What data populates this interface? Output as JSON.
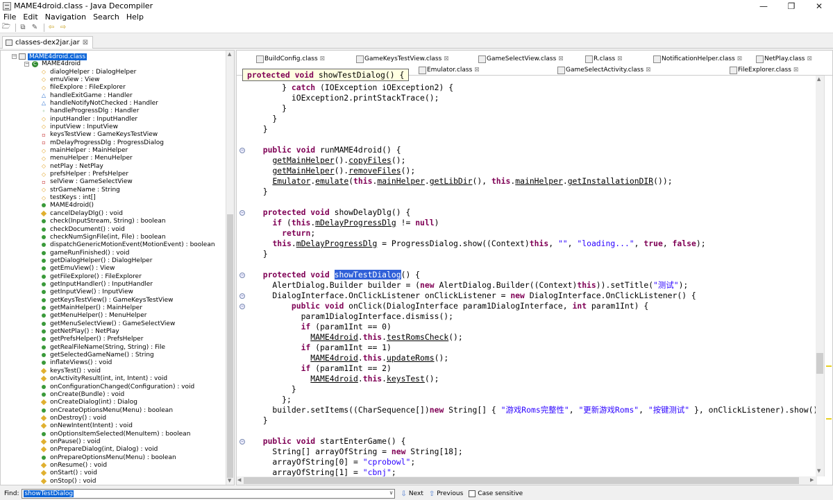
{
  "window": {
    "title": "MAME4droid.class - Java Decompiler",
    "minimize": "—",
    "restore": "❐",
    "close": "✕"
  },
  "menu": [
    "File",
    "Edit",
    "Navigation",
    "Search",
    "Help"
  ],
  "file_tab": {
    "label": "classes-dex2jar.jar",
    "close": "⊠"
  },
  "tree": {
    "root": "MAME4droid.class",
    "class": "MAME4droid",
    "items": [
      {
        "label": "dialogHelper : DialogHelper",
        "kind": "field-prot"
      },
      {
        "label": "emuView : View",
        "kind": "field-prot"
      },
      {
        "label": "fileExplore : FileExplorer",
        "kind": "field-prot"
      },
      {
        "label": "handleExitGame : Handler",
        "kind": "field-def"
      },
      {
        "label": "handleNotifyNotChecked : Handler",
        "kind": "field-def"
      },
      {
        "label": "handleProgressDlg : Handler",
        "kind": "field-pub"
      },
      {
        "label": "inputHandler : InputHandler",
        "kind": "field-prot"
      },
      {
        "label": "inputView : InputView",
        "kind": "field-prot"
      },
      {
        "label": "keysTestView : GameKeysTestView",
        "kind": "field-priv"
      },
      {
        "label": "mDelayProgressDlg : ProgressDialog",
        "kind": "field-priv"
      },
      {
        "label": "mainHelper : MainHelper",
        "kind": "field-prot"
      },
      {
        "label": "menuHelper : MenuHelper",
        "kind": "field-prot"
      },
      {
        "label": "netPlay : NetPlay",
        "kind": "field-prot"
      },
      {
        "label": "prefsHelper : PrefsHelper",
        "kind": "field-prot"
      },
      {
        "label": "selView : GameSelectView",
        "kind": "field-priv"
      },
      {
        "label": "strGameName : String",
        "kind": "field-prot"
      },
      {
        "label": "testKeys : int[]",
        "kind": "field-prot"
      },
      {
        "label": "MAME4droid()",
        "kind": "method"
      },
      {
        "label": "cancelDelayDlg() : void",
        "kind": "method-prot"
      },
      {
        "label": "check(InputStream, String) : boolean",
        "kind": "method"
      },
      {
        "label": "checkDocument() : void",
        "kind": "method"
      },
      {
        "label": "checkNumSignFile(int, File) : boolean",
        "kind": "method"
      },
      {
        "label": "dispatchGenericMotionEvent(MotionEvent) : boolean",
        "kind": "method"
      },
      {
        "label": "gameRunFinished() : void",
        "kind": "method"
      },
      {
        "label": "getDialogHelper() : DialogHelper",
        "kind": "method"
      },
      {
        "label": "getEmuView() : View",
        "kind": "method"
      },
      {
        "label": "getFileExplore() : FileExplorer",
        "kind": "method"
      },
      {
        "label": "getInputHandler() : InputHandler",
        "kind": "method"
      },
      {
        "label": "getInputView() : InputView",
        "kind": "method"
      },
      {
        "label": "getKeysTestView() : GameKeysTestView",
        "kind": "method"
      },
      {
        "label": "getMainHelper() : MainHelper",
        "kind": "method"
      },
      {
        "label": "getMenuHelper() : MenuHelper",
        "kind": "method"
      },
      {
        "label": "getMenuSelectView() : GameSelectView",
        "kind": "method"
      },
      {
        "label": "getNetPlay() : NetPlay",
        "kind": "method"
      },
      {
        "label": "getPrefsHelper() : PrefsHelper",
        "kind": "method"
      },
      {
        "label": "getRealFileName(String, String) : File",
        "kind": "method"
      },
      {
        "label": "getSelectedGameName() : String",
        "kind": "method"
      },
      {
        "label": "inflateViews() : void",
        "kind": "method"
      },
      {
        "label": "keysTest() : void",
        "kind": "method-prot"
      },
      {
        "label": "onActivityResult(int, int, Intent) : void",
        "kind": "method-prot"
      },
      {
        "label": "onConfigurationChanged(Configuration) : void",
        "kind": "method"
      },
      {
        "label": "onCreate(Bundle) : void",
        "kind": "method"
      },
      {
        "label": "onCreateDialog(int) : Dialog",
        "kind": "method-prot"
      },
      {
        "label": "onCreateOptionsMenu(Menu) : boolean",
        "kind": "method"
      },
      {
        "label": "onDestroy() : void",
        "kind": "method-prot"
      },
      {
        "label": "onNewIntent(Intent) : void",
        "kind": "method-prot"
      },
      {
        "label": "onOptionsItemSelected(MenuItem) : boolean",
        "kind": "method"
      },
      {
        "label": "onPause() : void",
        "kind": "method-prot"
      },
      {
        "label": "onPrepareDialog(int, Dialog) : void",
        "kind": "method-prot"
      },
      {
        "label": "onPrepareOptionsMenu(Menu) : boolean",
        "kind": "method"
      },
      {
        "label": "onResume() : void",
        "kind": "method-prot"
      },
      {
        "label": "onStart() : void",
        "kind": "method-prot"
      },
      {
        "label": "onStop() : void",
        "kind": "method-prot"
      }
    ]
  },
  "editor_tabs": {
    "row1": [
      "BuildConfig.class",
      "GameKeysTestView.class",
      "GameSelectView.class",
      "R.class",
      "NotificationHelper.class",
      "NetPlay.class"
    ],
    "row2": [
      "Emulator.class",
      "GameSelectActivity.class",
      "FileExplorer.class"
    ],
    "close_glyph": "⊠"
  },
  "hint": "protected void showTestDialog() {",
  "code": [
    [
      {
        "t": "      } "
      },
      {
        "t": "catch",
        "c": "kw"
      },
      {
        "t": " (IOException iOException2) {"
      }
    ],
    [
      {
        "t": "        iOException2.printStackTrace();"
      }
    ],
    [
      {
        "t": "      }"
      }
    ],
    [
      {
        "t": "    }"
      }
    ],
    [
      {
        "t": "  }"
      }
    ],
    [
      {
        "t": ""
      }
    ],
    [
      {
        "t": "  "
      },
      {
        "t": "public void",
        "c": "kw"
      },
      {
        "t": " runMAME4droid() {"
      }
    ],
    [
      {
        "t": "    "
      },
      {
        "t": "getMainHelper",
        "c": "ul"
      },
      {
        "t": "()."
      },
      {
        "t": "copyFiles",
        "c": "ul"
      },
      {
        "t": "();"
      }
    ],
    [
      {
        "t": "    "
      },
      {
        "t": "getMainHelper",
        "c": "ul"
      },
      {
        "t": "()."
      },
      {
        "t": "removeFiles",
        "c": "ul"
      },
      {
        "t": "();"
      }
    ],
    [
      {
        "t": "    "
      },
      {
        "t": "Emulator",
        "c": "ul"
      },
      {
        "t": "."
      },
      {
        "t": "emulate",
        "c": "ul"
      },
      {
        "t": "("
      },
      {
        "t": "this",
        "c": "kw"
      },
      {
        "t": "."
      },
      {
        "t": "mainHelper",
        "c": "ul"
      },
      {
        "t": "."
      },
      {
        "t": "getLibDir",
        "c": "ul"
      },
      {
        "t": "(), "
      },
      {
        "t": "this",
        "c": "kw"
      },
      {
        "t": "."
      },
      {
        "t": "mainHelper",
        "c": "ul"
      },
      {
        "t": "."
      },
      {
        "t": "getInstallationDIR",
        "c": "ul"
      },
      {
        "t": "());"
      }
    ],
    [
      {
        "t": "  }"
      }
    ],
    [
      {
        "t": ""
      }
    ],
    [
      {
        "t": "  "
      },
      {
        "t": "protected void",
        "c": "kw"
      },
      {
        "t": " showDelayDlg() {"
      }
    ],
    [
      {
        "t": "    "
      },
      {
        "t": "if",
        "c": "kw"
      },
      {
        "t": " ("
      },
      {
        "t": "this",
        "c": "kw"
      },
      {
        "t": "."
      },
      {
        "t": "mDelayProgressDlg",
        "c": "ul"
      },
      {
        "t": " != "
      },
      {
        "t": "null",
        "c": "kw"
      },
      {
        "t": ")"
      }
    ],
    [
      {
        "t": "      "
      },
      {
        "t": "return",
        "c": "kw"
      },
      {
        "t": ";"
      }
    ],
    [
      {
        "t": "    "
      },
      {
        "t": "this",
        "c": "kw"
      },
      {
        "t": "."
      },
      {
        "t": "mDelayProgressDlg",
        "c": "ul"
      },
      {
        "t": " = ProgressDialog.show((Context)"
      },
      {
        "t": "this",
        "c": "kw"
      },
      {
        "t": ", "
      },
      {
        "t": "\"\"",
        "c": "str"
      },
      {
        "t": ", "
      },
      {
        "t": "\"loading...\"",
        "c": "str"
      },
      {
        "t": ", "
      },
      {
        "t": "true",
        "c": "kw"
      },
      {
        "t": ", "
      },
      {
        "t": "false",
        "c": "kw"
      },
      {
        "t": ");"
      }
    ],
    [
      {
        "t": "  }"
      }
    ],
    [
      {
        "t": ""
      }
    ],
    [
      {
        "t": "  "
      },
      {
        "t": "protected void",
        "c": "kw"
      },
      {
        "t": " "
      },
      {
        "t": "showTestDialog",
        "c": "hl"
      },
      {
        "t": "() {"
      }
    ],
    [
      {
        "t": "    AlertDialog.Builder builder = ("
      },
      {
        "t": "new",
        "c": "kw"
      },
      {
        "t": " AlertDialog.Builder((Context)"
      },
      {
        "t": "this",
        "c": "kw"
      },
      {
        "t": ")).setTitle("
      },
      {
        "t": "\"测试\"",
        "c": "str"
      },
      {
        "t": ");"
      }
    ],
    [
      {
        "t": "    DialogInterface.OnClickListener onClickListener = "
      },
      {
        "t": "new",
        "c": "kw"
      },
      {
        "t": " DialogInterface.OnClickListener() {"
      }
    ],
    [
      {
        "t": "        "
      },
      {
        "t": "public void",
        "c": "kw"
      },
      {
        "t": " onClick(DialogInterface param1DialogInterface, "
      },
      {
        "t": "int",
        "c": "kw"
      },
      {
        "t": " param1Int) {"
      }
    ],
    [
      {
        "t": "          param1DialogInterface.dismiss();"
      }
    ],
    [
      {
        "t": "          "
      },
      {
        "t": "if",
        "c": "kw"
      },
      {
        "t": " (param1Int == 0)"
      }
    ],
    [
      {
        "t": "            "
      },
      {
        "t": "MAME4droid",
        "c": "ul"
      },
      {
        "t": "."
      },
      {
        "t": "this",
        "c": "kw"
      },
      {
        "t": "."
      },
      {
        "t": "testRomsCheck",
        "c": "ul"
      },
      {
        "t": "();"
      }
    ],
    [
      {
        "t": "          "
      },
      {
        "t": "if",
        "c": "kw"
      },
      {
        "t": " (param1Int == 1)"
      }
    ],
    [
      {
        "t": "            "
      },
      {
        "t": "MAME4droid",
        "c": "ul"
      },
      {
        "t": "."
      },
      {
        "t": "this",
        "c": "kw"
      },
      {
        "t": "."
      },
      {
        "t": "updateRoms",
        "c": "ul"
      },
      {
        "t": "();"
      }
    ],
    [
      {
        "t": "          "
      },
      {
        "t": "if",
        "c": "kw"
      },
      {
        "t": " (param1Int == 2)"
      }
    ],
    [
      {
        "t": "            "
      },
      {
        "t": "MAME4droid",
        "c": "ul"
      },
      {
        "t": "."
      },
      {
        "t": "this",
        "c": "kw"
      },
      {
        "t": "."
      },
      {
        "t": "keysTest",
        "c": "ul"
      },
      {
        "t": "();"
      }
    ],
    [
      {
        "t": "        }"
      }
    ],
    [
      {
        "t": "      };"
      }
    ],
    [
      {
        "t": "    builder.setItems((CharSequence[])"
      },
      {
        "t": "new",
        "c": "kw"
      },
      {
        "t": " String[] { "
      },
      {
        "t": "\"游戏Roms完整性\"",
        "c": "str"
      },
      {
        "t": ", "
      },
      {
        "t": "\"更新游戏Roms\"",
        "c": "str"
      },
      {
        "t": ", "
      },
      {
        "t": "\"按键测试\"",
        "c": "str"
      },
      {
        "t": " }, onClickListener).show();"
      }
    ],
    [
      {
        "t": "  }"
      }
    ],
    [
      {
        "t": ""
      }
    ],
    [
      {
        "t": "  "
      },
      {
        "t": "public void",
        "c": "kw"
      },
      {
        "t": " startEnterGame() {"
      }
    ],
    [
      {
        "t": "    String[] arrayOfString = "
      },
      {
        "t": "new",
        "c": "kw"
      },
      {
        "t": " String[18];"
      }
    ],
    [
      {
        "t": "    arrayOfString[0] = "
      },
      {
        "t": "\"cprobowl\"",
        "c": "str"
      },
      {
        "t": ";"
      }
    ],
    [
      {
        "t": "    arrayOfString[1] = "
      },
      {
        "t": "\"cbnj\"",
        "c": "str"
      },
      {
        "t": ";"
      }
    ]
  ],
  "find": {
    "label": "Find:",
    "value": "showTestDialog",
    "next": "Next",
    "previous": "Previous",
    "case_sensitive": "Case sensitive"
  }
}
